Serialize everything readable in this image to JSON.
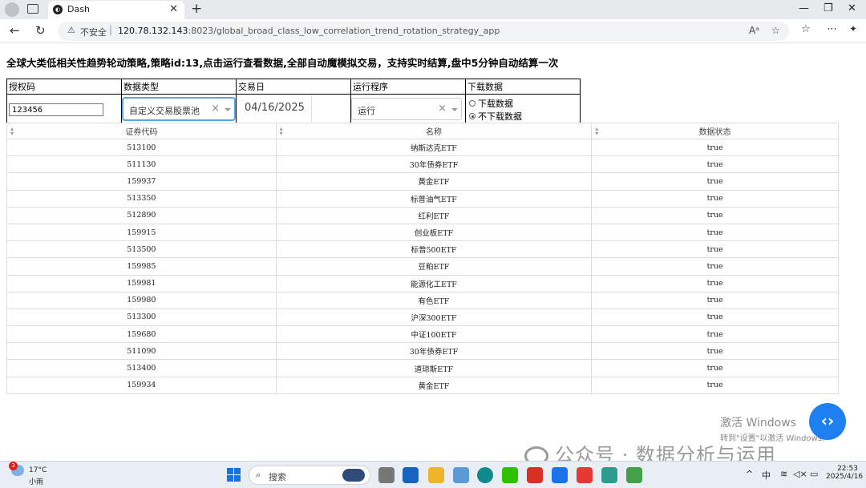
{
  "browser": {
    "tab_title": "Dash",
    "tab_favicon": "dash-icon",
    "insecure_label": "不安全",
    "url_host": "120.78.132.143",
    "url_path": ":8023/global_broad_class_low_correlation_trend_rotation_strategy_app"
  },
  "page": {
    "title": "全球大类低相关性趋势轮动策略,策略id:13,点击运行查看数据,全部自动魔模拟交易，支持实时结算,盘中5分钟自动结算一次"
  },
  "controls": {
    "auth_label": "授权码",
    "auth_value": "123456",
    "datatype_label": "数据类型",
    "datatype_value": "自定义交易股票池",
    "tradedate_label": "交易日",
    "tradedate_value": "04/16/2025",
    "program_label": "运行程序",
    "program_value": "运行",
    "download_label": "下载数据",
    "download_options": [
      "下载数据",
      "不下载数据"
    ],
    "download_selected": "不下载数据"
  },
  "table": {
    "headers": [
      "证券代码",
      "名称",
      "数据状态"
    ],
    "rows": [
      [
        "513100",
        "纳斯达克ETF",
        "true"
      ],
      [
        "511130",
        "30年债券ETF",
        "true"
      ],
      [
        "159937",
        "黄金ETF",
        "true"
      ],
      [
        "513350",
        "标普油气ETF",
        "true"
      ],
      [
        "512890",
        "红利ETF",
        "true"
      ],
      [
        "159915",
        "创业板ETF",
        "true"
      ],
      [
        "513500",
        "标普500ETF",
        "true"
      ],
      [
        "159985",
        "豆粕ETF",
        "true"
      ],
      [
        "159981",
        "能源化工ETF",
        "true"
      ],
      [
        "159980",
        "有色ETF",
        "true"
      ],
      [
        "513300",
        "沪深300ETF",
        "true"
      ],
      [
        "159680",
        "中证100ETF",
        "true"
      ],
      [
        "511090",
        "30年债券ETF",
        "true"
      ],
      [
        "513400",
        "道琼斯ETF",
        "true"
      ],
      [
        "159934",
        "黄金ETF",
        "true"
      ]
    ]
  },
  "overlay": {
    "activate_line1": "激活 Windows",
    "activate_line2": "转到\"设置\"以激活 Windows。",
    "watermark": "公众号 · 数据分析与运用"
  },
  "taskbar": {
    "weather_temp": "17°C",
    "weather_cond": "小雨",
    "weather_badge": "3",
    "search_label": "搜索",
    "ime": "中",
    "time": "22:53",
    "date": "2025/4/16"
  }
}
